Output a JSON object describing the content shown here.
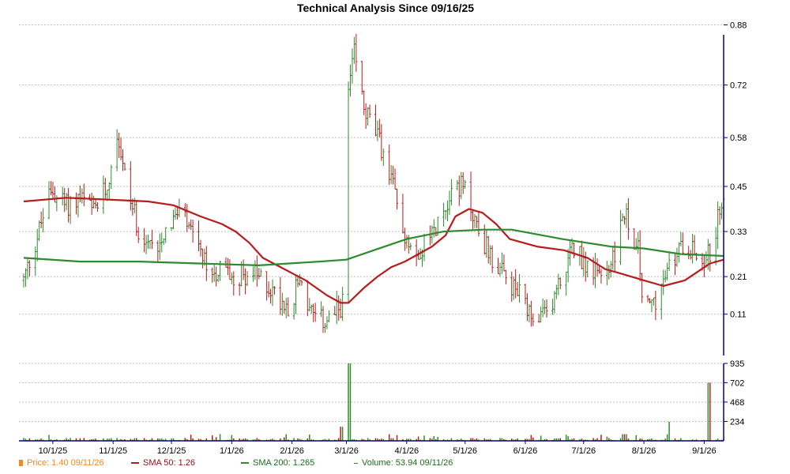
{
  "chart_data": {
    "type": "candlestick",
    "title": "Technical Analysis Since 09/16/25",
    "price_axis": {
      "ylim": [
        0.0,
        0.9
      ],
      "ticks": [
        0.11,
        0.21,
        0.33,
        0.45,
        0.58,
        0.72,
        0.88
      ],
      "tick_labels": [
        "0.11",
        "0.21",
        "0.33",
        "0.45",
        "0.58",
        "0.72",
        "0.88"
      ]
    },
    "volume_axis": {
      "ylim": [
        0,
        935
      ],
      "ticks": [
        234,
        468,
        702,
        935
      ],
      "tick_labels": [
        "234",
        "468",
        "702",
        "935"
      ]
    },
    "x_ticks": [
      {
        "date": "2025-10-01",
        "label": "10/1/25"
      },
      {
        "date": "2025-11-01",
        "label": "11/1/25"
      },
      {
        "date": "2025-12-01",
        "label": "12/1/25"
      },
      {
        "date": "2026-01-01",
        "label": "1/1/26"
      },
      {
        "date": "2026-02-01",
        "label": "2/1/26"
      },
      {
        "date": "2026-03-01",
        "label": "3/1/26"
      },
      {
        "date": "2026-04-01",
        "label": "4/1/26"
      },
      {
        "date": "2026-05-01",
        "label": "5/1/26"
      },
      {
        "date": "2026-06-01",
        "label": "6/1/26"
      },
      {
        "date": "2026-07-01",
        "label": "7/1/26"
      },
      {
        "date": "2026-08-01",
        "label": "8/1/26"
      },
      {
        "date": "2026-09-01",
        "label": "9/1/26"
      }
    ],
    "x_range": [
      "2025-09-16",
      "2026-09-11"
    ],
    "price_points": [
      [
        "2025-09-16",
        0.2
      ],
      [
        "2025-09-22",
        0.3
      ],
      [
        "2025-09-30",
        0.44
      ],
      [
        "2025-10-08",
        0.4
      ],
      [
        "2025-10-15",
        0.42
      ],
      [
        "2025-10-22",
        0.38
      ],
      [
        "2025-10-29",
        0.45
      ],
      [
        "2025-11-03",
        0.6
      ],
      [
        "2025-11-08",
        0.45
      ],
      [
        "2025-11-15",
        0.32
      ],
      [
        "2025-11-22",
        0.28
      ],
      [
        "2025-11-29",
        0.35
      ],
      [
        "2025-12-06",
        0.38
      ],
      [
        "2025-12-13",
        0.3
      ],
      [
        "2025-12-20",
        0.22
      ],
      [
        "2025-12-27",
        0.23
      ],
      [
        "2026-01-03",
        0.21
      ],
      [
        "2026-01-10",
        0.22
      ],
      [
        "2026-01-17",
        0.2
      ],
      [
        "2026-01-24",
        0.16
      ],
      [
        "2026-01-31",
        0.13
      ],
      [
        "2026-02-05",
        0.21
      ],
      [
        "2026-02-10",
        0.12
      ],
      [
        "2026-02-15",
        0.09
      ],
      [
        "2026-02-22",
        0.1
      ],
      [
        "2026-02-27",
        0.14
      ],
      [
        "2026-03-02",
        0.7
      ],
      [
        "2026-03-05",
        0.8
      ],
      [
        "2026-03-10",
        0.66
      ],
      [
        "2026-03-17",
        0.58
      ],
      [
        "2026-03-24",
        0.47
      ],
      [
        "2026-03-31",
        0.32
      ],
      [
        "2026-04-07",
        0.28
      ],
      [
        "2026-04-14",
        0.32
      ],
      [
        "2026-04-21",
        0.4
      ],
      [
        "2026-04-26",
        0.46
      ],
      [
        "2026-05-01",
        0.44
      ],
      [
        "2026-05-08",
        0.33
      ],
      [
        "2026-05-15",
        0.26
      ],
      [
        "2026-05-22",
        0.2
      ],
      [
        "2026-05-29",
        0.16
      ],
      [
        "2026-06-05",
        0.08
      ],
      [
        "2026-06-12",
        0.11
      ],
      [
        "2026-06-19",
        0.2
      ],
      [
        "2026-06-26",
        0.29
      ],
      [
        "2026-07-03",
        0.24
      ],
      [
        "2026-07-10",
        0.2
      ],
      [
        "2026-07-17",
        0.27
      ],
      [
        "2026-07-22",
        0.38
      ],
      [
        "2026-07-29",
        0.28
      ],
      [
        "2026-08-01",
        0.11
      ],
      [
        "2026-08-08",
        0.16
      ],
      [
        "2026-08-15",
        0.24
      ],
      [
        "2026-08-22",
        0.31
      ],
      [
        "2026-08-29",
        0.26
      ],
      [
        "2026-09-04",
        0.27
      ],
      [
        "2026-09-08",
        0.36
      ],
      [
        "2026-09-11",
        0.44
      ]
    ],
    "volume_spikes": [
      [
        "2026-02-27",
        170
      ],
      [
        "2026-03-02",
        935
      ],
      [
        "2026-06-05",
        40
      ],
      [
        "2026-07-22",
        80
      ],
      [
        "2026-08-15",
        230
      ],
      [
        "2026-09-04",
        702
      ]
    ],
    "series": [
      {
        "name": "SMA 50",
        "color": "#b71c1c",
        "points": [
          [
            "2025-09-16",
            0.41
          ],
          [
            "2025-10-08",
            0.42
          ],
          [
            "2025-10-29",
            0.415
          ],
          [
            "2025-11-19",
            0.41
          ],
          [
            "2025-12-02",
            0.4
          ],
          [
            "2025-12-16",
            0.37
          ],
          [
            "2025-12-27",
            0.35
          ],
          [
            "2026-01-03",
            0.33
          ],
          [
            "2026-01-10",
            0.3
          ],
          [
            "2026-01-17",
            0.26
          ],
          [
            "2026-01-28",
            0.23
          ],
          [
            "2026-02-08",
            0.2
          ],
          [
            "2026-02-19",
            0.16
          ],
          [
            "2026-02-26",
            0.14
          ],
          [
            "2026-03-02",
            0.14
          ],
          [
            "2026-03-10",
            0.18
          ],
          [
            "2026-03-17",
            0.21
          ],
          [
            "2026-03-24",
            0.235
          ],
          [
            "2026-03-31",
            0.25
          ],
          [
            "2026-04-07",
            0.27
          ],
          [
            "2026-04-14",
            0.29
          ],
          [
            "2026-04-21",
            0.32
          ],
          [
            "2026-04-26",
            0.37
          ],
          [
            "2026-05-03",
            0.39
          ],
          [
            "2026-05-10",
            0.38
          ],
          [
            "2026-05-17",
            0.35
          ],
          [
            "2026-05-24",
            0.31
          ],
          [
            "2026-05-31",
            0.3
          ],
          [
            "2026-06-07",
            0.29
          ],
          [
            "2026-06-21",
            0.28
          ],
          [
            "2026-07-03",
            0.26
          ],
          [
            "2026-07-12",
            0.23
          ],
          [
            "2026-07-19",
            0.22
          ],
          [
            "2026-08-01",
            0.2
          ],
          [
            "2026-08-11",
            0.185
          ],
          [
            "2026-08-22",
            0.2
          ],
          [
            "2026-09-04",
            0.245
          ],
          [
            "2026-09-11",
            0.255
          ]
        ]
      },
      {
        "name": "SMA 200",
        "color": "#2e8b2e",
        "points": [
          [
            "2025-09-16",
            0.26
          ],
          [
            "2025-10-15",
            0.25
          ],
          [
            "2025-11-15",
            0.25
          ],
          [
            "2025-12-15",
            0.245
          ],
          [
            "2026-01-15",
            0.24
          ],
          [
            "2026-02-15",
            0.25
          ],
          [
            "2026-03-01",
            0.255
          ],
          [
            "2026-03-15",
            0.28
          ],
          [
            "2026-04-01",
            0.31
          ],
          [
            "2026-04-20",
            0.33
          ],
          [
            "2026-05-10",
            0.335
          ],
          [
            "2026-05-25",
            0.335
          ],
          [
            "2026-06-20",
            0.31
          ],
          [
            "2026-07-15",
            0.29
          ],
          [
            "2026-08-01",
            0.285
          ],
          [
            "2026-08-20",
            0.27
          ],
          [
            "2026-09-11",
            0.265
          ]
        ]
      }
    ],
    "legend": [
      {
        "name": "Price",
        "value": "1.40",
        "date": "09/11/26",
        "color": "#f08a24",
        "mark": "square"
      },
      {
        "name": "SMA 50",
        "value": "1.26",
        "color": "#b71c1c",
        "mark": "line"
      },
      {
        "name": "SMA 200",
        "value": "1.265",
        "color": "#2e8b2e",
        "mark": "line"
      },
      {
        "name": "Volume",
        "value": "53.94",
        "date": "09/11/26",
        "color": "#2e8b2e",
        "mark": "dash"
      }
    ],
    "colors": {
      "up": "#2e8b2e",
      "down": "#b71c1c",
      "axis": "#00008b",
      "grid": "#bfbfbf"
    }
  },
  "legend_text": {
    "price": "Price: 1.40  09/11/26",
    "sma50": "SMA 50: 1.26",
    "sma200": "SMA 200: 1.265",
    "volume": "Volume: 53.94  09/11/26"
  }
}
